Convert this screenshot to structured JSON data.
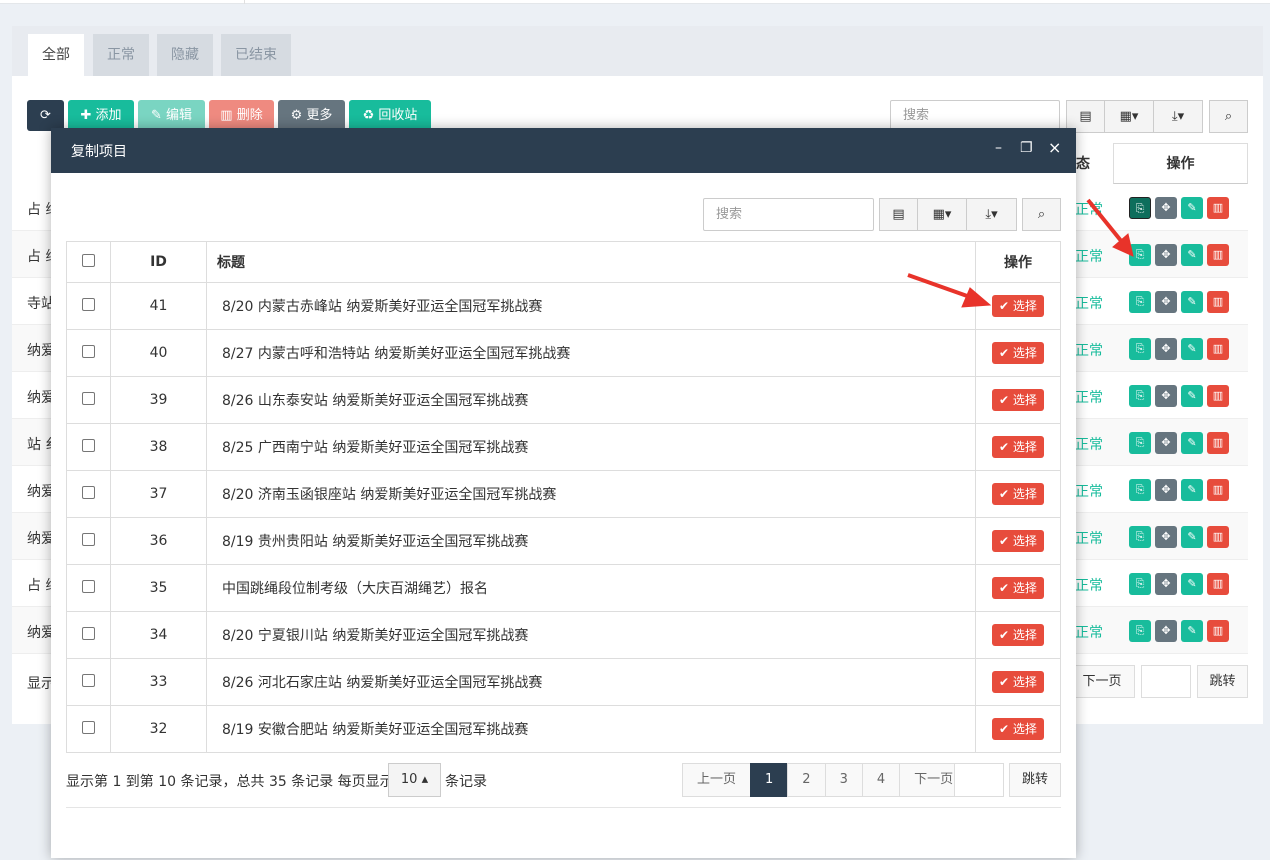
{
  "tabs": [
    "全部",
    "正常",
    "隐藏",
    "已结束"
  ],
  "toolbar": {
    "refresh_icon": "refresh-icon",
    "add": "添加",
    "edit": "编辑",
    "delete": "删除",
    "more": "更多",
    "recycle": "回收站",
    "search_placeholder": "搜索"
  },
  "bg_table": {
    "status_header": "态",
    "ops_header": "操作",
    "left_fragments": [
      "占 纳",
      "占 纳",
      "寺站",
      "纳爱",
      "纳爱",
      "站 纟",
      "纳爱",
      "纳爱",
      "占 纳",
      "纳爱"
    ],
    "status_text": "正常",
    "footer_left": "显示",
    "next_page": "下一页",
    "jump": "跳转"
  },
  "modal": {
    "title": "复制项目",
    "minimize": "–",
    "restore": "❐",
    "close": "×",
    "search_placeholder": "搜索",
    "columns": {
      "id": "ID",
      "title": "标题",
      "ops": "操作"
    },
    "select_label": "选择",
    "rows": [
      {
        "id": "41",
        "title": "8/20 内蒙古赤峰站 纳爱斯美好亚运全国冠军挑战赛"
      },
      {
        "id": "40",
        "title": "8/27 内蒙古呼和浩特站 纳爱斯美好亚运全国冠军挑战赛"
      },
      {
        "id": "39",
        "title": "8/26 山东泰安站 纳爱斯美好亚运全国冠军挑战赛"
      },
      {
        "id": "38",
        "title": "8/25 广西南宁站 纳爱斯美好亚运全国冠军挑战赛"
      },
      {
        "id": "37",
        "title": "8/20 济南玉函银座站 纳爱斯美好亚运全国冠军挑战赛"
      },
      {
        "id": "36",
        "title": "8/19 贵州贵阳站 纳爱斯美好亚运全国冠军挑战赛"
      },
      {
        "id": "35",
        "title": "中国跳绳段位制考级（大庆百湖绳艺）报名"
      },
      {
        "id": "34",
        "title": "8/20 宁夏银川站 纳爱斯美好亚运全国冠军挑战赛"
      },
      {
        "id": "33",
        "title": "8/26 河北石家庄站 纳爱斯美好亚运全国冠军挑战赛"
      },
      {
        "id": "32",
        "title": "8/19 安徽合肥站 纳爱斯美好亚运全国冠军挑战赛"
      }
    ],
    "footer": {
      "summary": "显示第 1 到第 10 条记录，总共 35 条记录 每页显示",
      "page_size": "10",
      "suffix": "条记录",
      "prev": "上一页",
      "pages": [
        "1",
        "2",
        "3",
        "4"
      ],
      "next": "下一页",
      "jump": "跳转"
    }
  },
  "colors": {
    "dark": "#2c3e50",
    "green": "#18bc9c",
    "red": "#e74c3c",
    "arrow": "#e8332a"
  }
}
